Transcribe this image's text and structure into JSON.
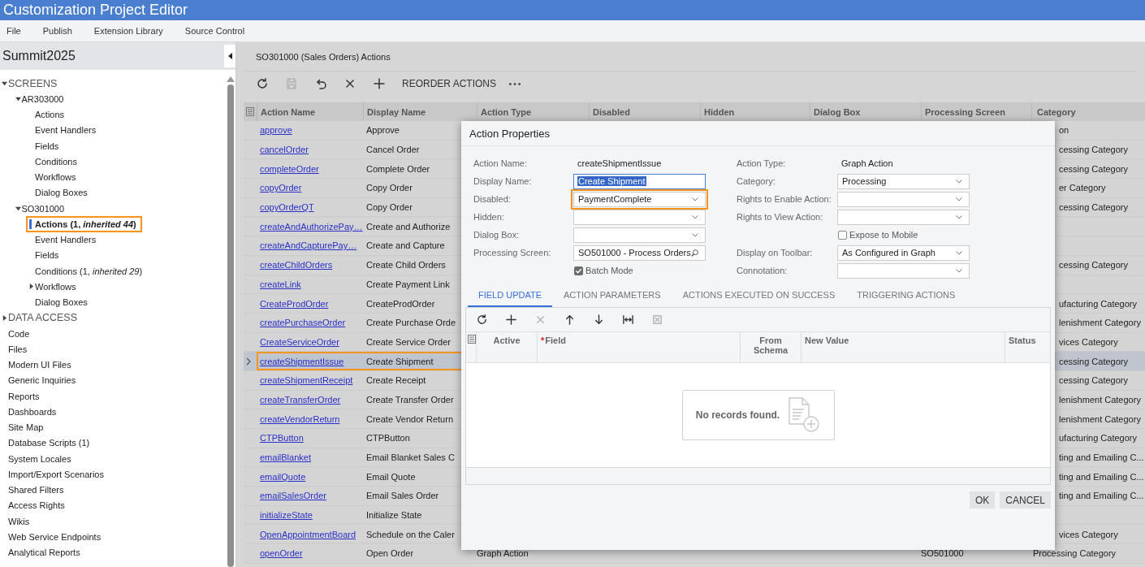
{
  "window": {
    "title": "Customization Project Editor"
  },
  "menu": [
    "File",
    "Publish",
    "Extension Library",
    "Source Control"
  ],
  "project": {
    "name": "Summit2025"
  },
  "tree": [
    {
      "label": "SCREENS",
      "kind": "section",
      "expanded": true,
      "selected": false,
      "children": [
        {
          "label": "AR303000",
          "kind": "item",
          "expanded": true,
          "selected": false,
          "children": [
            {
              "label": "Actions",
              "kind": "item",
              "selected": false
            },
            {
              "label": "Event Handlers",
              "kind": "item",
              "selected": false
            },
            {
              "label": "Fields",
              "kind": "item",
              "selected": false
            },
            {
              "label": "Conditions",
              "kind": "item",
              "selected": false
            },
            {
              "label": "Workflows",
              "kind": "item",
              "selected": false
            },
            {
              "label": "Dialog Boxes",
              "kind": "item",
              "selected": false
            }
          ]
        },
        {
          "label": "SO301000",
          "kind": "item",
          "expanded": true,
          "selected": false,
          "children": [
            {
              "label": "Actions (1, *inherited 44*)",
              "kind": "item",
              "selected": true,
              "callout": true
            },
            {
              "label": "Event Handlers",
              "kind": "item",
              "selected": false
            },
            {
              "label": "Fields",
              "kind": "item",
              "selected": false
            },
            {
              "label": "Conditions (1, *inherited 29*)",
              "kind": "item",
              "selected": false
            },
            {
              "label": "Workflows",
              "kind": "item",
              "expanded": false,
              "selected": false
            },
            {
              "label": "Dialog Boxes",
              "kind": "item",
              "selected": false
            }
          ]
        }
      ]
    },
    {
      "label": "DATA ACCESS",
      "kind": "section",
      "expanded": false,
      "selected": false
    },
    {
      "label": "Code",
      "kind": "item",
      "selected": false
    },
    {
      "label": "Files",
      "kind": "item",
      "selected": false
    },
    {
      "label": "Modern UI Files",
      "kind": "item",
      "selected": false
    },
    {
      "label": "Generic Inquiries",
      "kind": "item",
      "selected": false
    },
    {
      "label": "Reports",
      "kind": "item",
      "selected": false
    },
    {
      "label": "Dashboards",
      "kind": "item",
      "selected": false
    },
    {
      "label": "Site Map",
      "kind": "item",
      "selected": false
    },
    {
      "label": "Database Scripts (1)",
      "kind": "item",
      "selected": false
    },
    {
      "label": "System Locales",
      "kind": "item",
      "selected": false
    },
    {
      "label": "Import/Export Scenarios",
      "kind": "item",
      "selected": false
    },
    {
      "label": "Shared Filters",
      "kind": "item",
      "selected": false
    },
    {
      "label": "Access Rights",
      "kind": "item",
      "selected": false
    },
    {
      "label": "Wikis",
      "kind": "item",
      "selected": false
    },
    {
      "label": "Web Service Endpoints",
      "kind": "item",
      "selected": false
    },
    {
      "label": "Analytical Reports",
      "kind": "item",
      "selected": false
    }
  ],
  "screen": {
    "title": "SO301000 (Sales Orders) Actions",
    "toolbar": [
      {
        "kind": "refresh",
        "disabled": false
      },
      {
        "kind": "save",
        "disabled": true
      },
      {
        "kind": "undo",
        "disabled": false
      },
      {
        "kind": "delete",
        "disabled": false
      },
      {
        "kind": "add",
        "disabled": false
      },
      {
        "kind": "text",
        "label": "REORDER ACTIONS",
        "disabled": false
      },
      {
        "kind": "more",
        "disabled": false
      }
    ],
    "columns": [
      "Action Name",
      "Display Name",
      "Action Type",
      "Disabled",
      "Hidden",
      "Dialog Box",
      "Processing Screen",
      "Category"
    ],
    "rows": [
      {
        "action_name": "approve",
        "display_name": "Approve",
        "category": "on",
        "selected": false
      },
      {
        "action_name": "cancelOrder",
        "display_name": "Cancel Order",
        "category": "cessing Category",
        "selected": false
      },
      {
        "action_name": "completeOrder",
        "display_name": "Complete Order",
        "category": "cessing Category",
        "selected": false
      },
      {
        "action_name": "copyOrder",
        "display_name": "Copy Order",
        "category": "er Category",
        "selected": false
      },
      {
        "action_name": "copyOrderQT",
        "display_name": "Copy Order",
        "category": "cessing Category",
        "selected": false
      },
      {
        "action_name": "createAndAuthorizePay…",
        "display_name": "Create and Authorize",
        "selected": false
      },
      {
        "action_name": "createAndCapturePay…",
        "display_name": "Create and Capture",
        "selected": false
      },
      {
        "action_name": "createChildOrders",
        "display_name": "Create Child Orders",
        "category": "cessing Category",
        "selected": false
      },
      {
        "action_name": "createLink",
        "display_name": "Create Payment Link",
        "selected": false
      },
      {
        "action_name": "CreateProdOrder",
        "display_name": "CreateProdOrder",
        "category": "ufacturing Category",
        "selected": false
      },
      {
        "action_name": "createPurchaseOrder",
        "display_name": "Create Purchase Orde",
        "category": "lenishment Category",
        "selected": false
      },
      {
        "action_name": "CreateServiceOrder",
        "display_name": "Create Service Order",
        "category": "vices Category",
        "selected": false
      },
      {
        "action_name": "createShipmentIssue",
        "display_name": "Create Shipment",
        "category": "cessing Category",
        "selected": true,
        "callout": true
      },
      {
        "action_name": "createShipmentReceipt",
        "display_name": "Create Receipt",
        "category": "cessing Category",
        "selected": false
      },
      {
        "action_name": "createTransferOrder",
        "display_name": "Create Transfer Order",
        "category": "lenishment Category",
        "selected": false
      },
      {
        "action_name": "createVendorReturn",
        "display_name": "Create Vendor Return",
        "category": "lenishment Category",
        "selected": false
      },
      {
        "action_name": "CTPButton",
        "display_name": "CTPButton",
        "category": "ufacturing Category",
        "selected": false
      },
      {
        "action_name": "emailBlanket",
        "display_name": "Email Blanket Sales C",
        "category": "ting and Emailing C...",
        "selected": false
      },
      {
        "action_name": "emailQuote",
        "display_name": "Email Quote",
        "category": "ting and Emailing C...",
        "selected": false
      },
      {
        "action_name": "emailSalesOrder",
        "display_name": "Email Sales Order",
        "category": "ting and Emailing C...",
        "selected": false
      },
      {
        "action_name": "initializeState",
        "display_name": "Initialize State",
        "selected": false
      },
      {
        "action_name": "OpenAppointmentBoard",
        "display_name": "Schedule on the Caler",
        "category": "vices Category",
        "selected": false
      },
      {
        "action_name": "openOrder",
        "display_name": "Open Order",
        "action_type": "Graph Action",
        "processing_screen": "SO501000",
        "category": "Processing Category",
        "selected": false
      }
    ]
  },
  "dialog": {
    "title": "Action Properties",
    "left_fields": [
      {
        "kind": "static",
        "label": "Action Name:",
        "value": "createShipmentIssue"
      },
      {
        "kind": "text",
        "label": "Display Name:",
        "value": "Create Shipment",
        "text_highlighted": true
      },
      {
        "kind": "select",
        "label": "Disabled:",
        "value": "PaymentComplete",
        "callout": true
      },
      {
        "kind": "select",
        "label": "Hidden:"
      },
      {
        "kind": "select",
        "label": "Dialog Box:"
      },
      {
        "kind": "lookup",
        "label": "Processing Screen:",
        "value": "SO501000 - Process Orders"
      },
      {
        "kind": "checkbox",
        "label": "Batch Mode",
        "checked": true
      }
    ],
    "right_fields": [
      {
        "kind": "static",
        "label": "Action Type:",
        "value": "Graph Action"
      },
      {
        "kind": "select",
        "label": "Category:",
        "value": "Processing"
      },
      {
        "kind": "select",
        "label": "Rights to Enable Action:"
      },
      {
        "kind": "select",
        "label": "Rights to View Action:"
      },
      {
        "kind": "checkbox",
        "label": "Expose to Mobile",
        "checked": false
      },
      {
        "kind": "select",
        "label": "Display on Toolbar:",
        "value": "As Configured in Graph"
      },
      {
        "kind": "select",
        "label": "Connotation:"
      }
    ],
    "tabs": [
      {
        "label": "FIELD UPDATE",
        "selected": true
      },
      {
        "label": "ACTION PARAMETERS",
        "selected": false
      },
      {
        "label": "ACTIONS EXECUTED ON SUCCESS",
        "selected": false
      },
      {
        "label": "TRIGGERING ACTIONS",
        "selected": false
      }
    ],
    "toolbar": [
      {
        "kind": "refresh",
        "disabled": false
      },
      {
        "kind": "add",
        "disabled": false
      },
      {
        "kind": "delete",
        "disabled": true
      },
      {
        "kind": "up",
        "disabled": false
      },
      {
        "kind": "down",
        "disabled": false
      },
      {
        "kind": "fit",
        "disabled": false
      },
      {
        "kind": "export",
        "disabled": true
      }
    ],
    "columns": [
      {
        "label": "Active"
      },
      {
        "label": "Field",
        "required_mark": "*"
      },
      {
        "label": "From Schema"
      },
      {
        "label": "New Value"
      },
      {
        "label": "Status"
      }
    ],
    "empty_message": "No records found.",
    "buttons": [
      "OK",
      "CANCEL"
    ]
  }
}
